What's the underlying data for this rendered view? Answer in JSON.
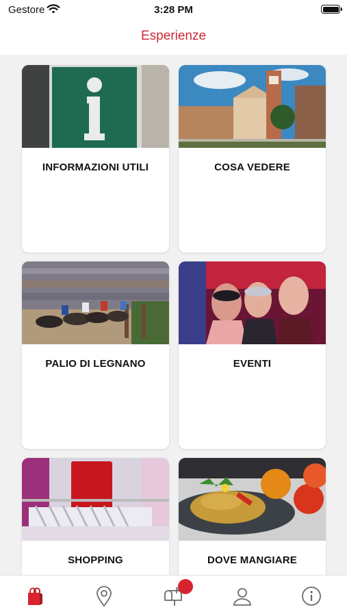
{
  "status_bar": {
    "carrier": "Gestore",
    "time": "3:28 PM"
  },
  "nav": {
    "title": "Esperienze"
  },
  "cards": [
    {
      "label": "INFORMAZIONI UTILI",
      "image": "info-sign-photo"
    },
    {
      "label": "COSA VEDERE",
      "image": "church-square-photo"
    },
    {
      "label": "PALIO DI LEGNANO",
      "image": "horse-race-photo"
    },
    {
      "label": "EVENTI",
      "image": "party-masks-photo"
    },
    {
      "label": "SHOPPING",
      "image": "sale-clothes-photo"
    },
    {
      "label": "DOVE MANGIARE",
      "image": "pasta-dish-photo"
    }
  ],
  "tab_bar": {
    "items": [
      "shopping-bag-icon",
      "location-pin-icon",
      "mailbox-icon",
      "user-icon",
      "info-circle-icon"
    ],
    "active_color": "#d7242f"
  },
  "colors": {
    "accent": "#cf2a37",
    "background": "#f1f1f1"
  }
}
